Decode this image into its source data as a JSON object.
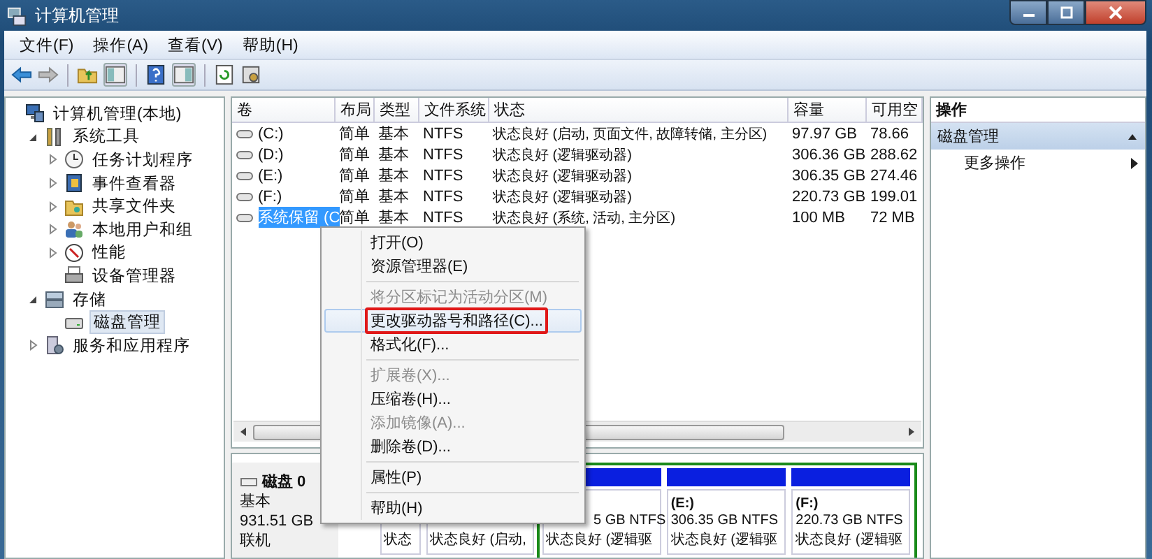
{
  "window": {
    "title": "计算机管理"
  },
  "menu_bar": [
    "文件(F)",
    "操作(A)",
    "查看(V)",
    "帮助(H)"
  ],
  "tree": {
    "label": "计算机管理(本地)",
    "selected": false,
    "children": [
      {
        "label": "系统工具",
        "expanded": true,
        "selected": false,
        "children": [
          {
            "label": "任务计划程序",
            "expanded": false,
            "selected": false
          },
          {
            "label": "事件查看器",
            "expanded": false,
            "selected": false
          },
          {
            "label": "共享文件夹",
            "expanded": false,
            "selected": false
          },
          {
            "label": "本地用户和组",
            "expanded": false,
            "selected": false
          },
          {
            "label": "性能",
            "expanded": false,
            "selected": false
          },
          {
            "label": "设备管理器",
            "selected": false
          }
        ]
      },
      {
        "label": "存储",
        "expanded": true,
        "selected": false,
        "children": [
          {
            "label": "磁盘管理",
            "selected": true
          }
        ]
      },
      {
        "label": "服务和应用程序",
        "expanded": false,
        "selected": false
      }
    ]
  },
  "volume_table": {
    "columns": [
      "卷",
      "布局",
      "类型",
      "文件系统",
      "状态",
      "容量",
      "可用空"
    ],
    "rows": [
      {
        "selected": false,
        "cells": [
          "(C:)",
          "简单",
          "基本",
          "NTFS",
          "状态良好 (启动, 页面文件, 故障转储, 主分区)",
          "97.97 GB",
          "78.66"
        ]
      },
      {
        "selected": false,
        "cells": [
          "(D:)",
          "简单",
          "基本",
          "NTFS",
          "状态良好 (逻辑驱动器)",
          "306.36 GB",
          "288.62"
        ]
      },
      {
        "selected": false,
        "cells": [
          "(E:)",
          "简单",
          "基本",
          "NTFS",
          "状态良好 (逻辑驱动器)",
          "306.35 GB",
          "274.46"
        ]
      },
      {
        "selected": false,
        "cells": [
          "(F:)",
          "简单",
          "基本",
          "NTFS",
          "状态良好 (逻辑驱动器)",
          "220.73 GB",
          "199.01"
        ]
      },
      {
        "selected": true,
        "cells": [
          "系统保留 (C",
          "简单",
          "基本",
          "NTFS",
          "状态良好 (系统, 活动, 主分区)",
          "100 MB",
          "72 MB"
        ]
      }
    ]
  },
  "disk": {
    "name": "磁盘 0",
    "type": "基本",
    "size": "931.51 GB",
    "status": "联机",
    "partitions": [
      {
        "kind": "primary",
        "status": "状态"
      },
      {
        "kind": "primary",
        "status": "状态良好 (启动,"
      },
      {
        "kind": "logical",
        "size": "5 GB NTFS",
        "status": "状态良好 (逻辑驱"
      },
      {
        "kind": "logical",
        "name": "(E:)",
        "size": "306.35 GB NTFS",
        "status": "状态良好 (逻辑驱"
      },
      {
        "kind": "logical",
        "name": "(F:)",
        "size": "220.73 GB NTFS",
        "status": "状态良好 (逻辑驱"
      }
    ]
  },
  "context_menu": [
    {
      "kind": "item",
      "label": "打开(O)",
      "disabled": false,
      "selected": false,
      "outlined": false
    },
    {
      "kind": "item",
      "label": "资源管理器(E)",
      "disabled": false,
      "selected": false,
      "outlined": false
    },
    {
      "kind": "separator"
    },
    {
      "kind": "item",
      "label": "将分区标记为活动分区(M)",
      "disabled": true,
      "selected": false,
      "outlined": false
    },
    {
      "kind": "item",
      "label": "更改驱动器号和路径(C)...",
      "disabled": false,
      "selected": true,
      "outlined": true
    },
    {
      "kind": "item",
      "label": "格式化(F)...",
      "disabled": false,
      "selected": false,
      "outlined": false
    },
    {
      "kind": "separator"
    },
    {
      "kind": "item",
      "label": "扩展卷(X)...",
      "disabled": true,
      "selected": false,
      "outlined": false
    },
    {
      "kind": "item",
      "label": "压缩卷(H)...",
      "disabled": false,
      "selected": false,
      "outlined": false
    },
    {
      "kind": "item",
      "label": "添加镜像(A)...",
      "disabled": true,
      "selected": false,
      "outlined": false
    },
    {
      "kind": "item",
      "label": "删除卷(D)...",
      "disabled": false,
      "selected": false,
      "outlined": false
    },
    {
      "kind": "separator"
    },
    {
      "kind": "item",
      "label": "属性(P)",
      "disabled": false,
      "selected": false,
      "outlined": false
    },
    {
      "kind": "separator"
    },
    {
      "kind": "item",
      "label": "帮助(H)",
      "disabled": false,
      "selected": false,
      "outlined": false
    }
  ],
  "action_pane": {
    "title": "操作",
    "section": {
      "label": "磁盘管理",
      "expanded": true
    },
    "items": [
      "更多操作"
    ]
  }
}
